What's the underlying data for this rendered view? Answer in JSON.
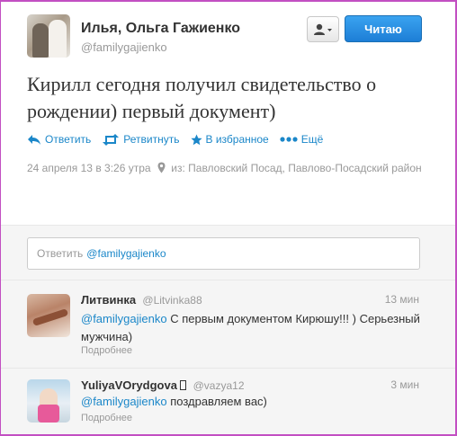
{
  "tweet": {
    "author_name": "Илья, Ольга Гажиенко",
    "author_handle": "@familygajienko",
    "follow_label": "Читаю",
    "text": "Кирилл сегодня получил свидетельство о рождении) первый документ)",
    "actions": {
      "reply": "Ответить",
      "retweet": "Ретвитнуть",
      "favorite": "В избранное",
      "more": "Ещё"
    },
    "timestamp": "24 апреля 13 в 3:26 утра",
    "location_prefix": "из:",
    "location": "Павловский Посад, Павлово-Посадский район"
  },
  "reply_box": {
    "prefix": "Ответить",
    "mention": "@familygajienko"
  },
  "replies": [
    {
      "name": "Литвинка",
      "handle": "@Litvinka88",
      "time": "13 мин",
      "mention": "@familygajienko",
      "text": "С первым документом Кирюшу!!! ) Серьезный мужчина)",
      "more": "Подробнее"
    },
    {
      "name": "YuliyaVOrydgova",
      "handle": "@vazya12",
      "time": "3 мин",
      "mention": "@familygajienko",
      "text": "поздравляем вас)",
      "more": "Подробнее"
    }
  ],
  "colors": {
    "link": "#1b87c9",
    "follow_button": "#1d7ed6",
    "frame": "#c24fc2"
  }
}
